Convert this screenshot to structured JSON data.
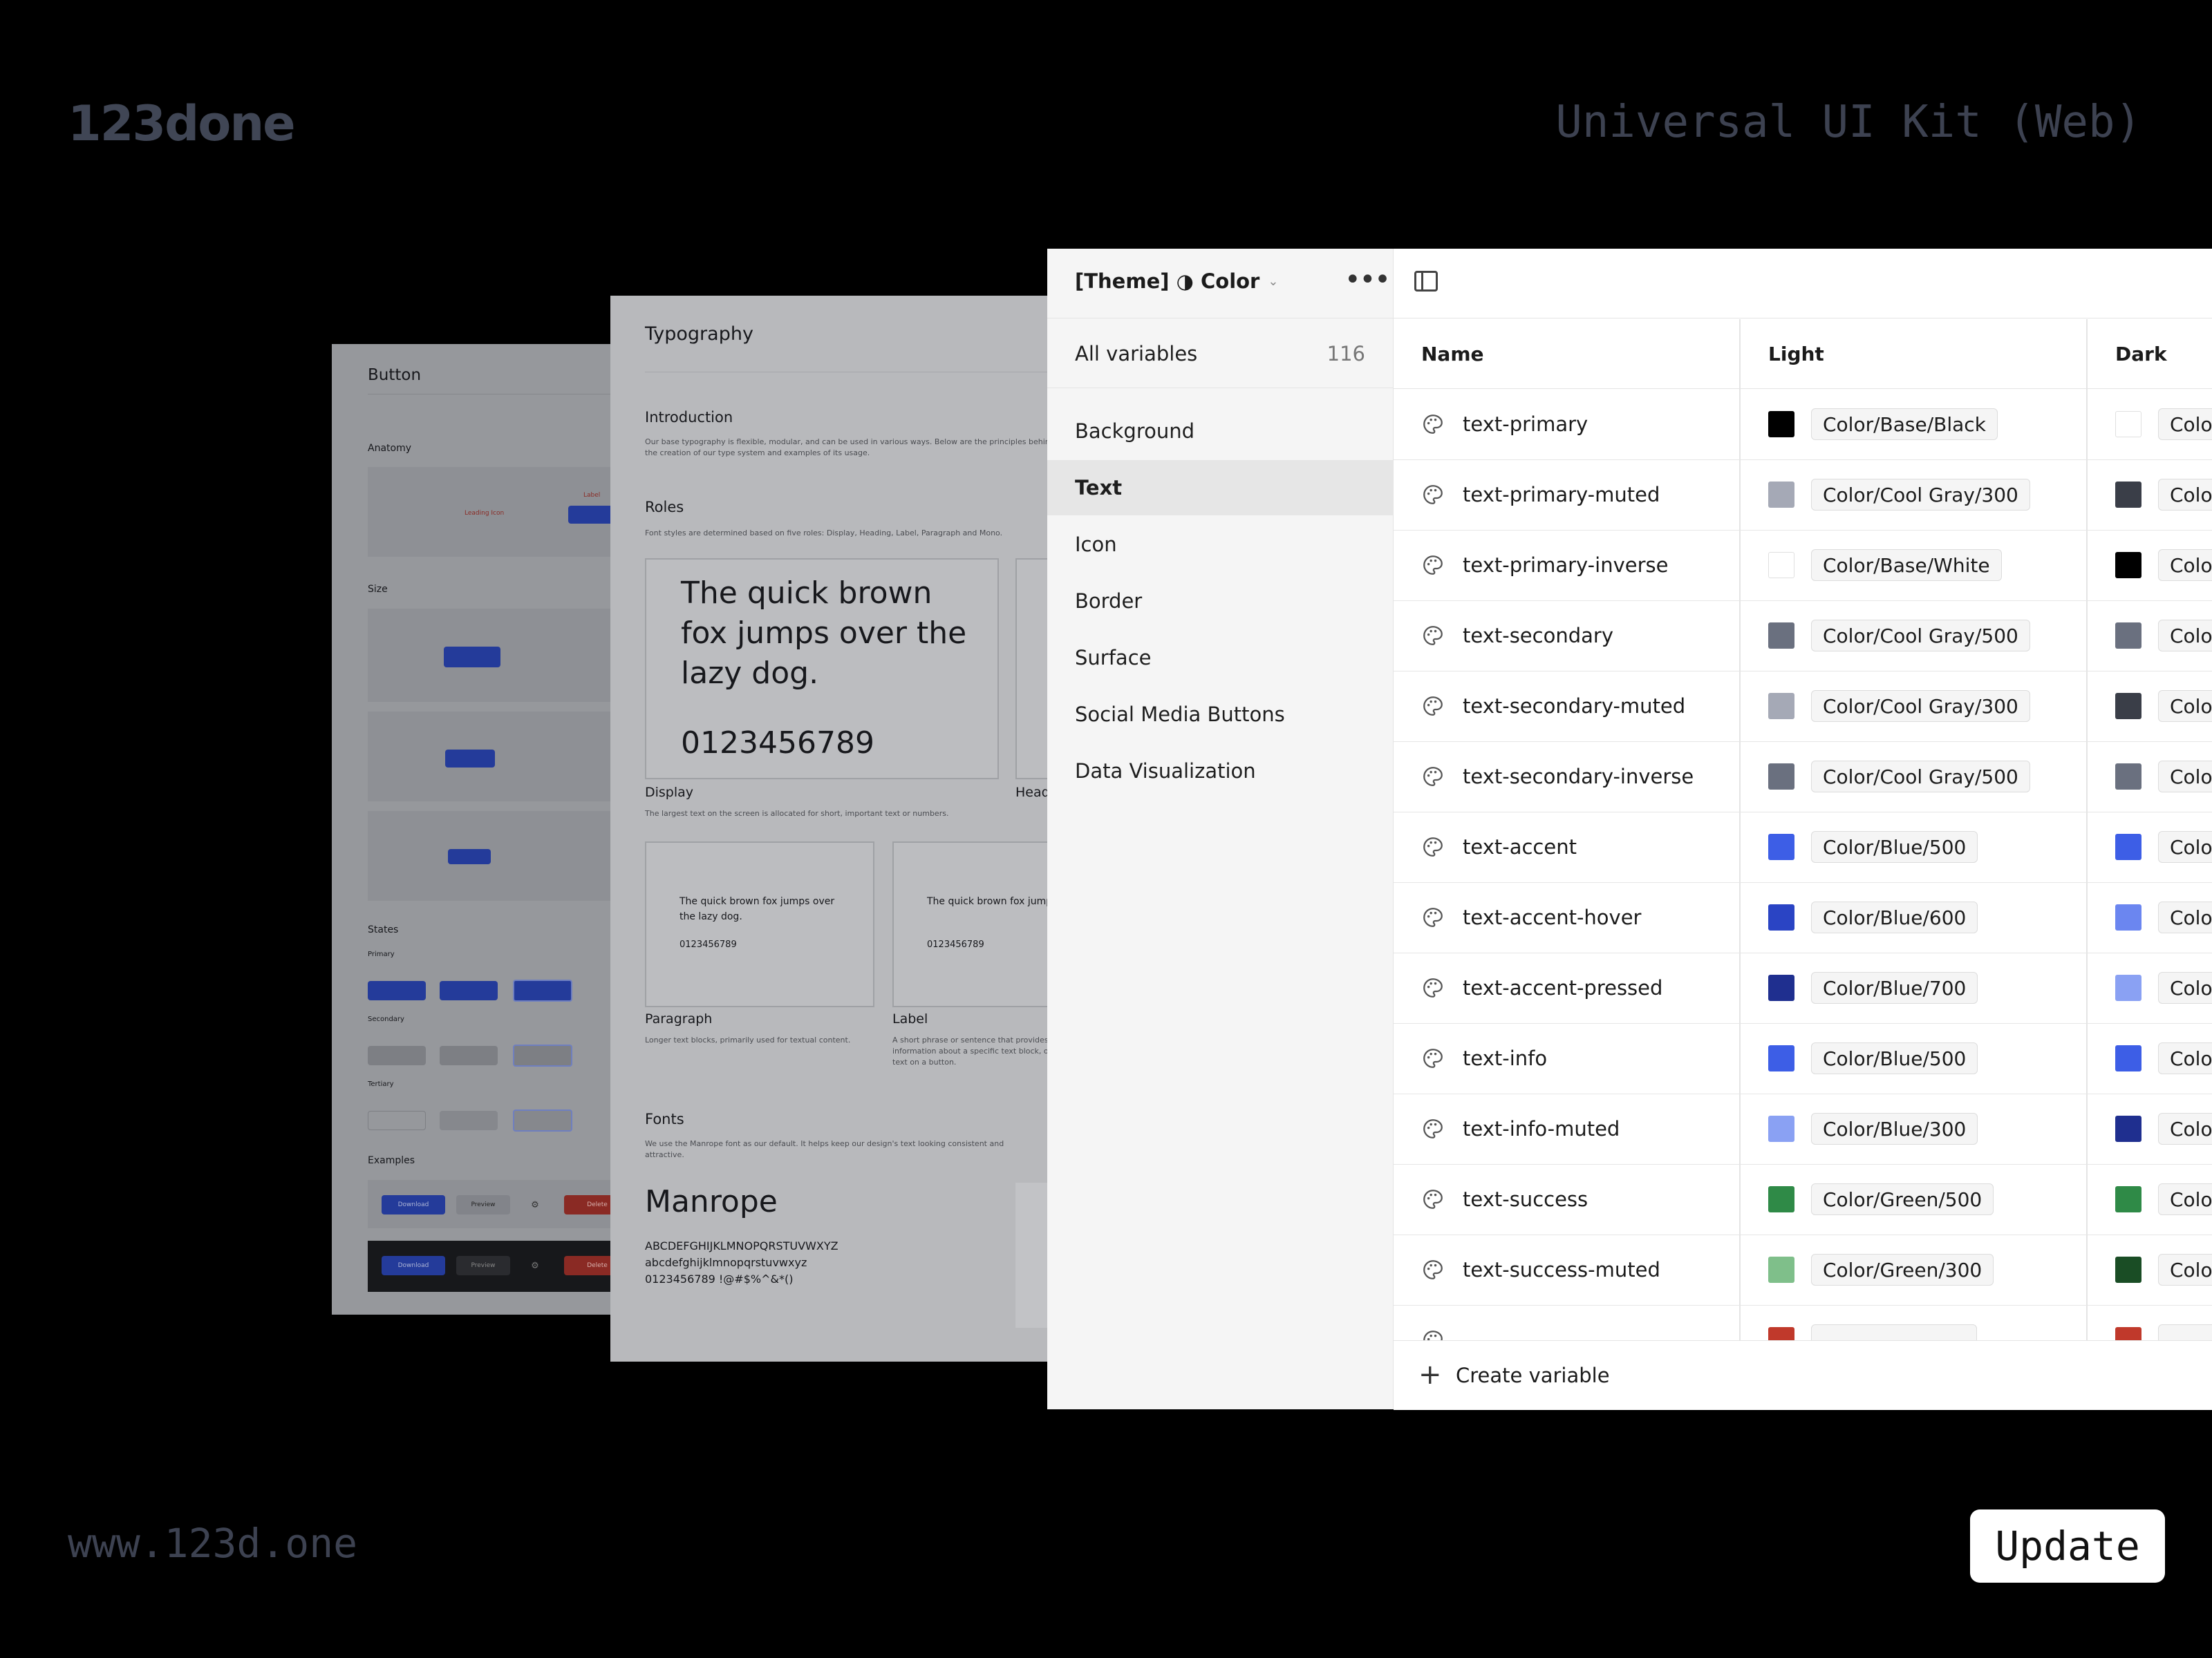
{
  "branding": {
    "logo": "123done",
    "kit_title": "Universal UI Kit (Web)",
    "url": "www.123d.one",
    "update_label": "Update"
  },
  "button_sheet": {
    "title": "Button",
    "anatomy": "Anatomy",
    "size": "Size",
    "states": "States",
    "primary": "Primary",
    "secondary": "Secondary",
    "tertiary": "Tertiary",
    "examples": "Examples",
    "label": "Label",
    "leading_icon": "Leading Icon",
    "download": "Download",
    "preview": "Preview",
    "delete": "Delete"
  },
  "typography_sheet": {
    "title": "Typography",
    "intro_heading": "Introduction",
    "intro_text": "Our base typography is flexible, modular, and can be used in various ways. Below are the principles behind the creation of our type system and examples of its usage.",
    "roles_heading": "Roles",
    "roles_text": "Font styles are determined based on five roles: Display, Heading, Label, Paragraph and Mono.",
    "sample_text": "The quick brown fox jumps over the lazy dog.",
    "sample_digits": "0123456789",
    "display_label": "Display",
    "display_text": "The largest text on the screen is allocated for short, important text or numbers.",
    "heading_label": "Head",
    "paragraph_label": "Paragraph",
    "paragraph_text": "Longer text blocks, primarily used for textual content.",
    "label_label": "Label",
    "label_text": "A short phrase or sentence that provides information about a specific text block, or text on a button.",
    "fonts_heading": "Fonts",
    "fonts_text": "We use the Manrope font as our default. It helps keep our design's text looking consistent and attractive.",
    "font_name": "Manrope",
    "uppercase": "ABCDEFGHIJKLMNOPQRSTUVWXYZ",
    "lowercase": "abcdefghijklmnopqrstuvwxyz",
    "digits_symbols": "0123456789 !@#$%^&*()"
  },
  "variables_panel": {
    "collection": "[Theme] ◑ Color",
    "all_variables": "All variables",
    "all_count": "116",
    "groups": [
      "Background",
      "Text",
      "Icon",
      "Border",
      "Surface",
      "Social Media Buttons",
      "Data Visualization"
    ],
    "active_group": "Text",
    "columns": {
      "name": "Name",
      "light": "Light",
      "dark": "Dark"
    },
    "create_label": "Create variable",
    "rows": [
      {
        "name": "text-primary",
        "light": "Color/Base/Black",
        "light_color": "#000000",
        "dark_color": "#ffffff",
        "dark": "Color"
      },
      {
        "name": "text-primary-muted",
        "light": "Color/Cool Gray/300",
        "light_color": "#a5a9b6",
        "dark_color": "#3a3e48",
        "dark": "Color"
      },
      {
        "name": "text-primary-inverse",
        "light": "Color/Base/White",
        "light_color": "#ffffff",
        "dark_color": "#000000",
        "dark": "Color"
      },
      {
        "name": "text-secondary",
        "light": "Color/Cool Gray/500",
        "light_color": "#6a707f",
        "dark_color": "#6a707f",
        "dark": "Color"
      },
      {
        "name": "text-secondary-muted",
        "light": "Color/Cool Gray/300",
        "light_color": "#a5a9b6",
        "dark_color": "#3a3e48",
        "dark": "Color"
      },
      {
        "name": "text-secondary-inverse",
        "light": "Color/Cool Gray/500",
        "light_color": "#6a707f",
        "dark_color": "#6a707f",
        "dark": "Color"
      },
      {
        "name": "text-accent",
        "light": "Color/Blue/500",
        "light_color": "#3d5ee6",
        "dark_color": "#3d5ee6",
        "dark": "Color"
      },
      {
        "name": "text-accent-hover",
        "light": "Color/Blue/600",
        "light_color": "#2a44c4",
        "dark_color": "#6b86f0",
        "dark": "Color"
      },
      {
        "name": "text-accent-pressed",
        "light": "Color/Blue/700",
        "light_color": "#1f2f8f",
        "dark_color": "#8aa1f3",
        "dark": "Color"
      },
      {
        "name": "text-info",
        "light": "Color/Blue/500",
        "light_color": "#3d5ee6",
        "dark_color": "#3d5ee6",
        "dark": "Color"
      },
      {
        "name": "text-info-muted",
        "light": "Color/Blue/300",
        "light_color": "#8aa1f3",
        "dark_color": "#1f2f8f",
        "dark": "Color"
      },
      {
        "name": "text-success",
        "light": "Color/Green/500",
        "light_color": "#2f8a47",
        "dark_color": "#2f8a47",
        "dark": "Color"
      },
      {
        "name": "text-success-muted",
        "light": "Color/Green/300",
        "light_color": "#7fbf8a",
        "dark_color": "#1a4d25",
        "dark": "Color"
      },
      {
        "name": "",
        "light": "",
        "light_color": "#c0392b",
        "dark_color": "#c0392b",
        "dark": ""
      }
    ]
  }
}
